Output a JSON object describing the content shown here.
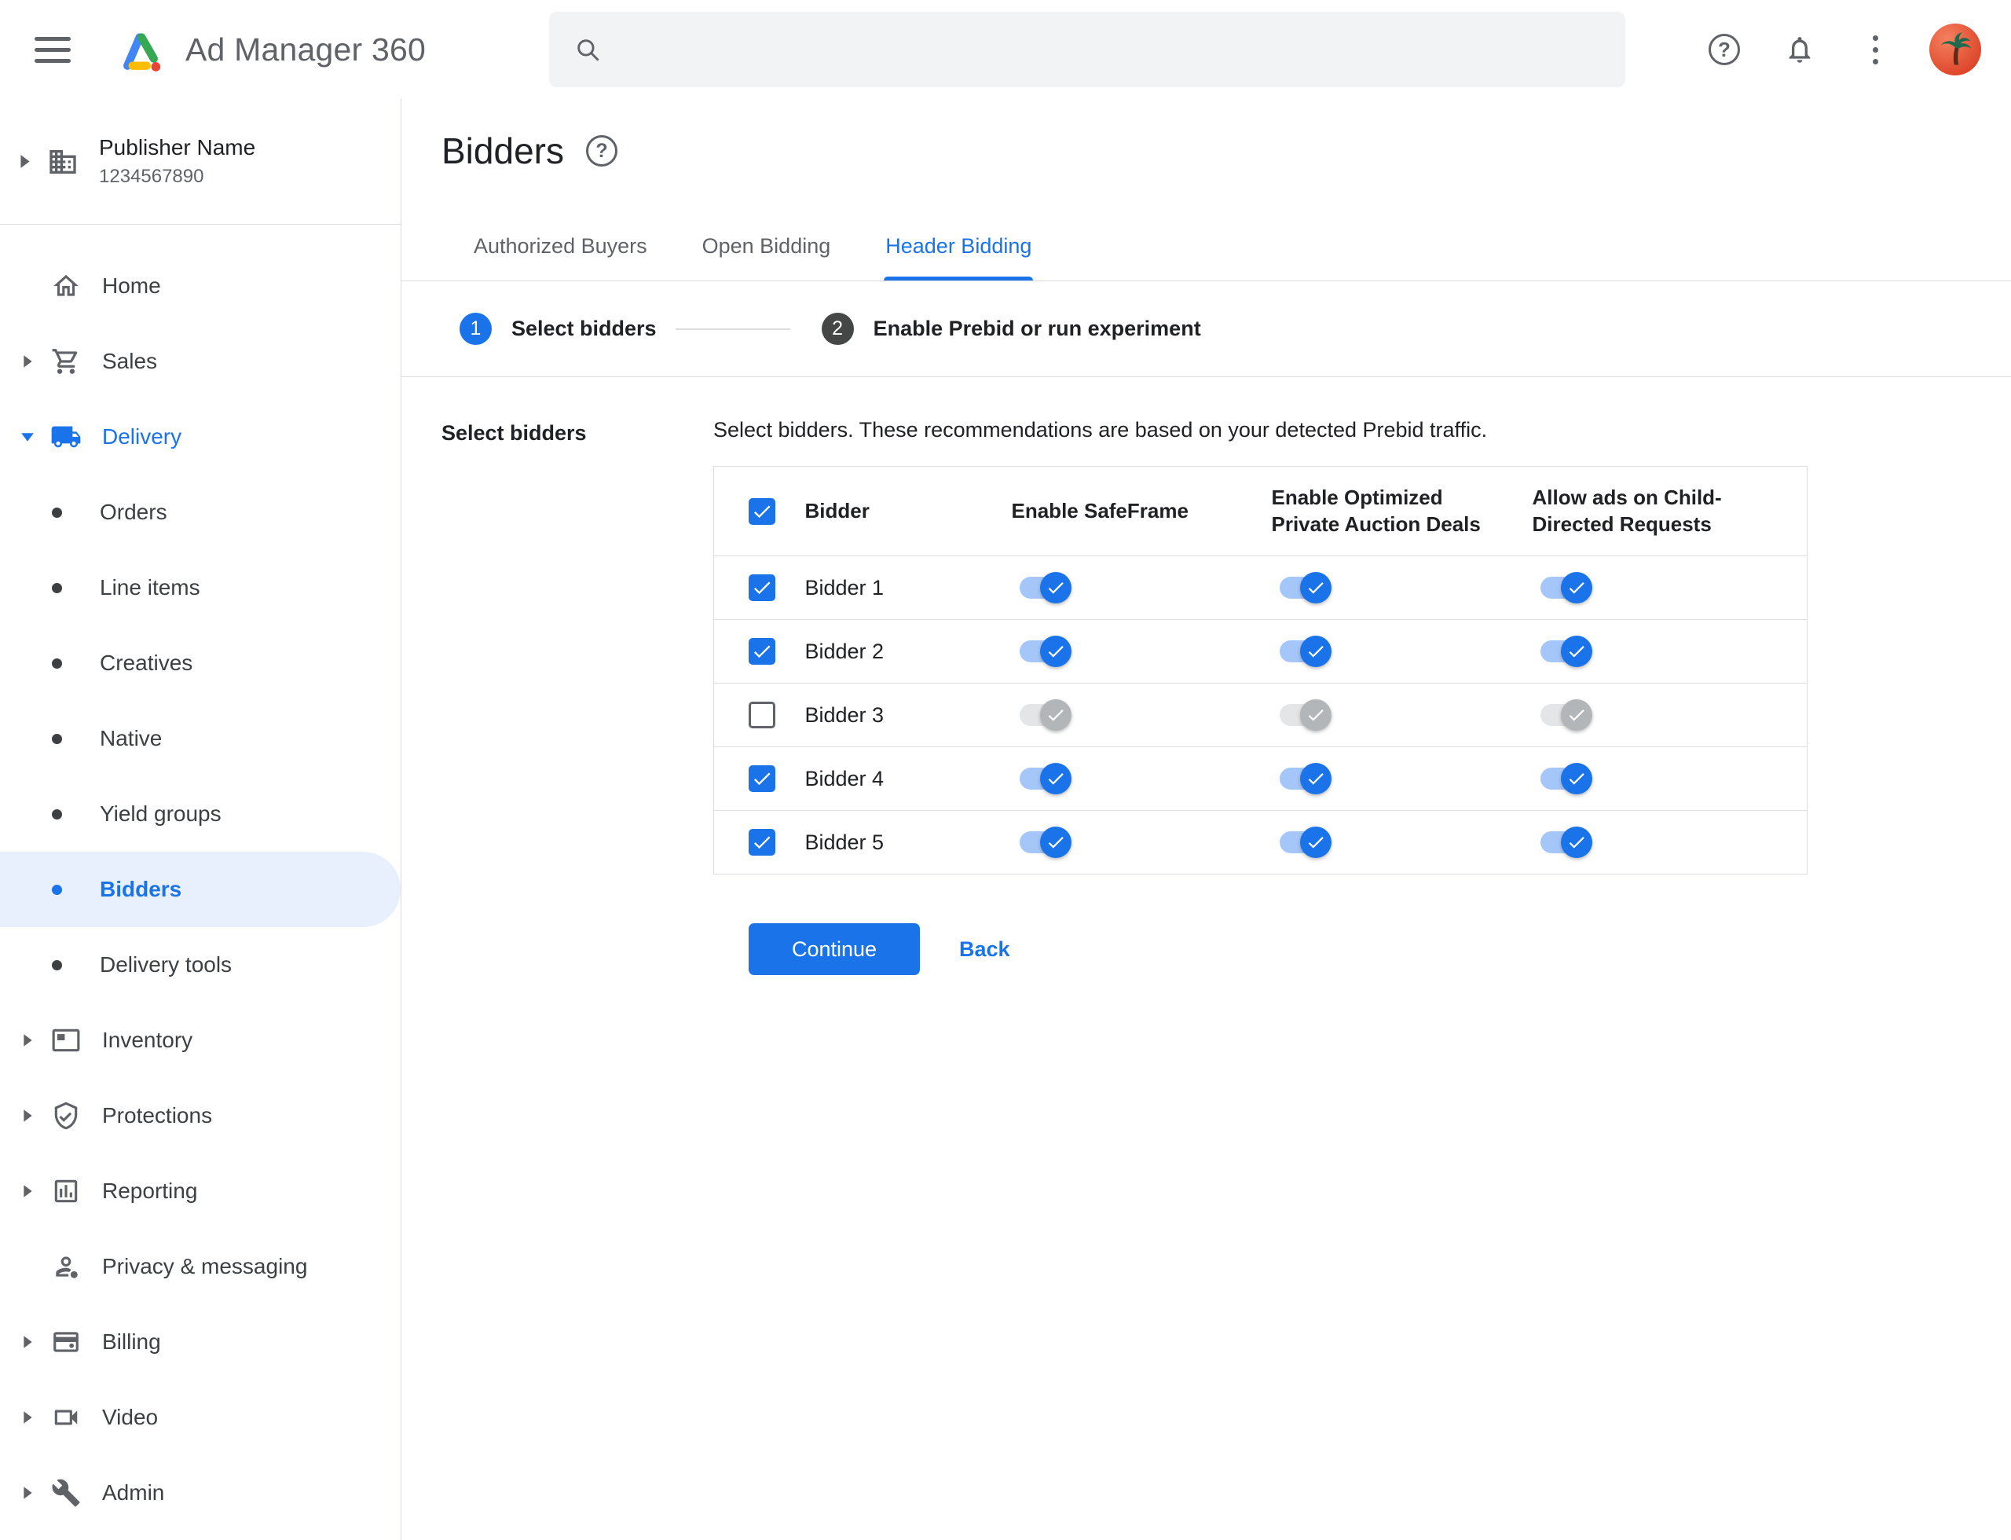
{
  "topbar": {
    "app_title": "Ad Manager 360",
    "search": {
      "placeholder": "",
      "value": ""
    }
  },
  "icons": {
    "menu": "hamburger-icon",
    "search": "magnifier-icon",
    "help": "question-circle-icon",
    "notifications": "bell-icon",
    "more": "vertical-dots-icon",
    "avatar": "palm-tree-avatar"
  },
  "colors": {
    "accent_blue": "#1a73e8",
    "active_item_bg": "#e8f0fe",
    "toggle_on_track": "#a5c6f9",
    "toggle_on_thumb": "#1a73e8",
    "toggle_off_track": "#e3e5e6",
    "toggle_off_thumb": "#b3b6b9",
    "text_primary": "#202124",
    "text_secondary": "#5f6368",
    "border": "#dadce0"
  },
  "sidebar": {
    "publisher": {
      "name": "Publisher Name",
      "id": "1234567890"
    },
    "items": [
      {
        "label": "Home",
        "icon": "home",
        "chevron": false
      },
      {
        "label": "Sales",
        "icon": "shopping-cart",
        "chevron": true
      },
      {
        "label": "Delivery",
        "icon": "truck",
        "chevron": true,
        "expanded": true,
        "active": true
      },
      {
        "label": "Inventory",
        "icon": "inventory",
        "chevron": true
      },
      {
        "label": "Protections",
        "icon": "shield-check",
        "chevron": true
      },
      {
        "label": "Reporting",
        "icon": "bar-chart",
        "chevron": true
      },
      {
        "label": "Privacy & messaging",
        "icon": "person",
        "chevron": false
      },
      {
        "label": "Billing",
        "icon": "credit-card",
        "chevron": true
      },
      {
        "label": "Video",
        "icon": "video-camera",
        "chevron": true
      },
      {
        "label": "Admin",
        "icon": "wrench",
        "chevron": true
      }
    ],
    "delivery_subitems": [
      {
        "label": "Orders",
        "active": false
      },
      {
        "label": "Line items",
        "active": false
      },
      {
        "label": "Creatives",
        "active": false
      },
      {
        "label": "Native",
        "active": false
      },
      {
        "label": "Yield groups",
        "active": false
      },
      {
        "label": "Bidders",
        "active": true
      },
      {
        "label": "Delivery tools",
        "active": false
      }
    ]
  },
  "main": {
    "page_title": "Bidders",
    "tabs": [
      {
        "label": "Authorized Buyers",
        "active": false
      },
      {
        "label": "Open Bidding",
        "active": false
      },
      {
        "label": "Header Bidding",
        "active": true
      }
    ],
    "stepper": [
      {
        "number": "1",
        "label": "Select bidders",
        "state": "current"
      },
      {
        "number": "2",
        "label": "Enable Prebid or run experiment",
        "state": "upcoming"
      }
    ],
    "section_label": "Select bidders",
    "description": "Select bidders. These recommendations are based on your detected Prebid traffic.",
    "table": {
      "select_all_checked": true,
      "columns": [
        "Bidder",
        "Enable SafeFrame",
        "Enable Optimized Private Auction Deals",
        "Allow ads on Child-Directed Requests"
      ],
      "rows": [
        {
          "name": "Bidder 1",
          "checked": true,
          "enable_safeframe": true,
          "enable_optimized_private_auction_deals": true,
          "allow_ads_child_directed": true
        },
        {
          "name": "Bidder 2",
          "checked": true,
          "enable_safeframe": true,
          "enable_optimized_private_auction_deals": true,
          "allow_ads_child_directed": true
        },
        {
          "name": "Bidder 3",
          "checked": false,
          "enable_safeframe": false,
          "enable_optimized_private_auction_deals": false,
          "allow_ads_child_directed": false
        },
        {
          "name": "Bidder 4",
          "checked": true,
          "enable_safeframe": true,
          "enable_optimized_private_auction_deals": true,
          "allow_ads_child_directed": true
        },
        {
          "name": "Bidder 5",
          "checked": true,
          "enable_safeframe": true,
          "enable_optimized_private_auction_deals": true,
          "allow_ads_child_directed": true
        }
      ]
    },
    "continue_button": "Continue",
    "back_button": "Back"
  }
}
